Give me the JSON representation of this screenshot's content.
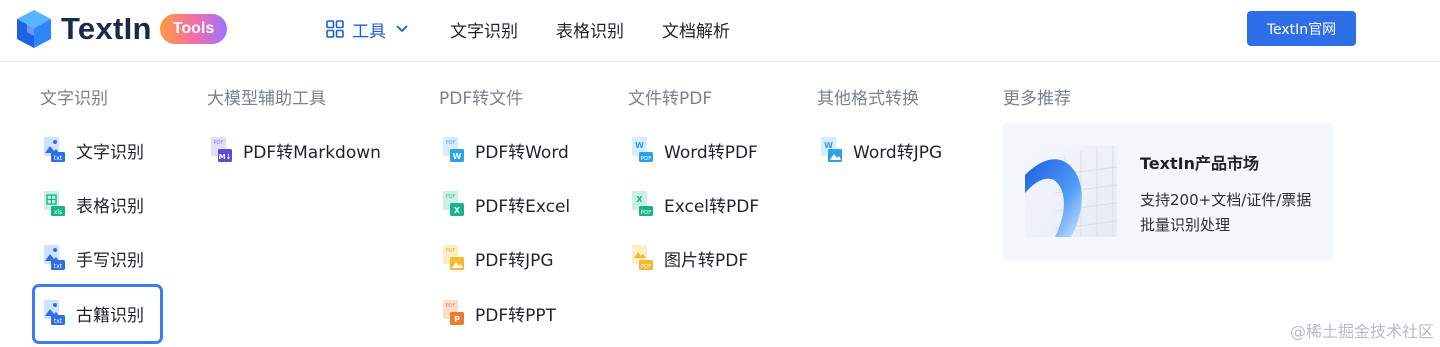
{
  "header": {
    "logo_text": "TextIn",
    "logo_badge": "Tools",
    "nav": {
      "tools_label": "工具",
      "items": [
        "文字识别",
        "表格识别",
        "文档解析"
      ]
    },
    "cta_label": "TextIn官网"
  },
  "menu": {
    "columns": [
      {
        "title": "文字识别",
        "items": [
          "文字识别",
          "表格识别",
          "手写识别",
          "古籍识别"
        ]
      },
      {
        "title": "大模型辅助工具",
        "items": [
          "PDF转Markdown"
        ]
      },
      {
        "title": "PDF转文件",
        "items": [
          "PDF转Word",
          "PDF转Excel",
          "PDF转JPG",
          "PDF转PPT"
        ]
      },
      {
        "title": "文件转PDF",
        "items": [
          "Word转PDF",
          "Excel转PDF",
          "图片转PDF"
        ]
      },
      {
        "title": "其他格式转换",
        "items": [
          "Word转JPG"
        ]
      },
      {
        "title": "更多推荐"
      }
    ],
    "highlighted_item": "古籍识别"
  },
  "recommend": {
    "title": "TextIn产品市场",
    "desc": "支持200+文档/证件/票据批量识别处理"
  },
  "watermark": "@稀土掘金技术社区",
  "colors": {
    "accent": "#2f6ee9",
    "highlight_border": "#3d7bf2",
    "column_title": "#7a8190",
    "card_bg": "#f3f6fa"
  },
  "icons": {
    "image_doc": "image-doc-icon",
    "table_doc": "table-doc-icon",
    "markdown_doc": "markdown-doc-icon",
    "word_doc": "word-doc-icon",
    "excel_doc": "excel-doc-icon",
    "jpg_doc": "jpg-doc-icon",
    "ppt_doc": "ppt-doc-icon",
    "pdf_doc": "pdf-doc-icon"
  }
}
